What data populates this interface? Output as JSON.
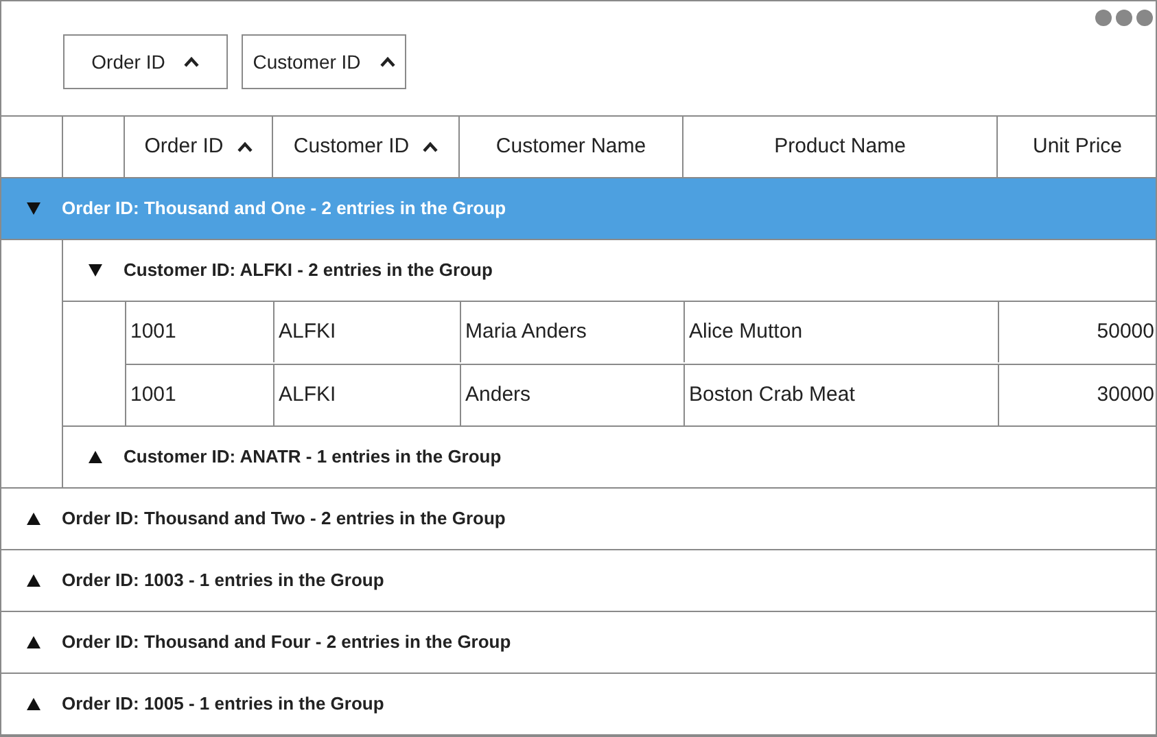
{
  "group_panel": {
    "chips": [
      {
        "label": "Order ID",
        "sorted": true
      },
      {
        "label": "Customer ID",
        "sorted": true
      }
    ]
  },
  "columns": [
    {
      "label": "Order ID",
      "sorted": true,
      "numeric": false
    },
    {
      "label": "Customer ID",
      "sorted": true,
      "numeric": false
    },
    {
      "label": "Customer Name",
      "sorted": false,
      "numeric": false
    },
    {
      "label": "Product Name",
      "sorted": false,
      "numeric": false
    },
    {
      "label": "Unit Price",
      "sorted": false,
      "numeric": true
    }
  ],
  "groups": [
    {
      "label": "Order ID: Thousand and One - 2 entries in the Group",
      "expanded": true,
      "selected": true,
      "children": [
        {
          "label": "Customer ID: ALFKI - 2 entries in the Group",
          "expanded": true,
          "rows": [
            [
              "1001",
              "ALFKI",
              "Maria Anders",
              "Alice Mutton",
              "50000"
            ],
            [
              "1001",
              "ALFKI",
              "Anders",
              "Boston Crab Meat",
              "30000"
            ]
          ]
        },
        {
          "label": "Customer ID: ANATR - 1 entries in the Group",
          "expanded": false
        }
      ]
    },
    {
      "label": "Order ID: Thousand and Two - 2 entries in the Group",
      "expanded": false,
      "selected": false
    },
    {
      "label": "Order ID: 1003 - 1 entries in the Group",
      "expanded": false,
      "selected": false
    },
    {
      "label": "Order ID: Thousand and Four - 2 entries in the Group",
      "expanded": false,
      "selected": false
    },
    {
      "label": "Order ID: 1005 - 1 entries in the Group",
      "expanded": false,
      "selected": false
    }
  ]
}
